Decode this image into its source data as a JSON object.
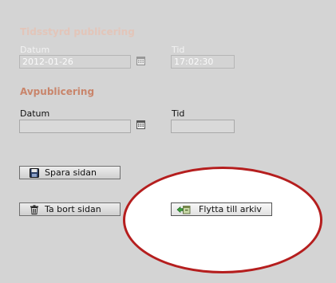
{
  "timed_publishing": {
    "title": "Tidsstyrd publicering",
    "date_label": "Datum",
    "date_value": "2012-01-26",
    "time_label": "Tid",
    "time_value": "17:02:30"
  },
  "unpublishing": {
    "title": "Avpublicering",
    "date_label": "Datum",
    "date_value": "",
    "time_label": "Tid",
    "time_value": ""
  },
  "buttons": {
    "save": "Spara sidan",
    "delete": "Ta bort sidan",
    "archive": "Flytta till arkiv"
  },
  "colors": {
    "highlight_oval": "#b51e1e",
    "section_title": "#c9856b"
  }
}
